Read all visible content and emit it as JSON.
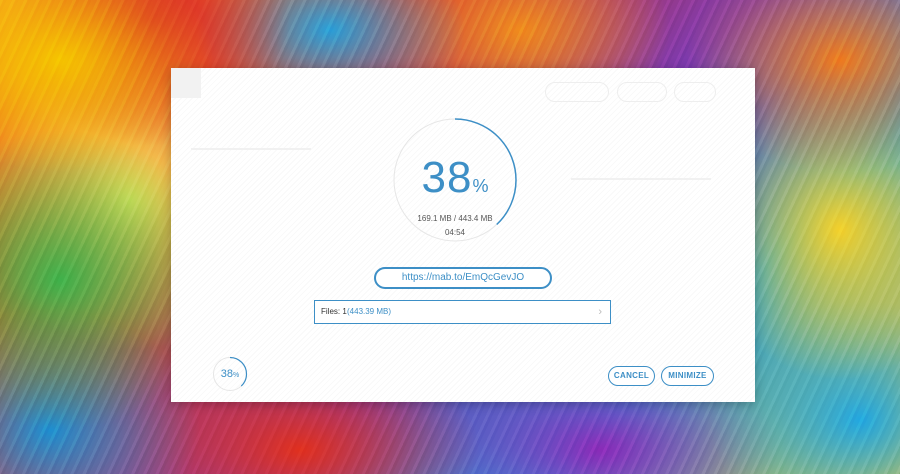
{
  "progress": {
    "percent_value": "38",
    "percent_sign": "%",
    "fraction": 0.38,
    "size": "169.1 MB / 443.4 MB",
    "time": "04:54"
  },
  "link": {
    "url": "https://mab.to/EmQcGevJO"
  },
  "files": {
    "label": "Files: 1",
    "size": "(443.39 MB)",
    "chevron": "›"
  },
  "mini_progress": {
    "value": "38",
    "sign": "%"
  },
  "buttons": {
    "cancel": "CANCEL",
    "minimize": "MINIMIZE"
  },
  "colors": {
    "accent": "#3d8fc6"
  }
}
